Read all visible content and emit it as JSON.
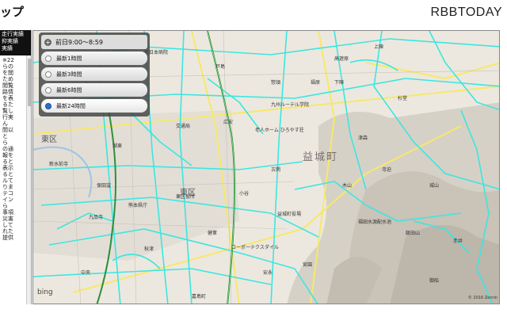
{
  "page": {
    "title": "ップ",
    "brand": "RBBTODAY"
  },
  "sidebar": {
    "header_lines": [
      "走行実績",
      "抑実績",
      "実績"
    ],
    "list_lines": [
      "※22",
      "らの",
      "を閲",
      "ため",
      "閲覧",
      "",
      "路情",
      "を表",
      "るた",
      "覧し",
      "行実",
      "ん",
      "",
      "間以",
      "と",
      "ら",
      "",
      "",
      "の通",
      "報を",
      "",
      "ると",
      "表示",
      "ると",
      "",
      "ルて",
      "りま",
      "テコ",
      "イン",
      "ら",
      "",
      "事項",
      "",
      "災害",
      "して",
      "れた",
      "提供"
    ]
  },
  "panel": {
    "header_label": "前日9:00～8:59",
    "options": [
      {
        "label": "最新1時間",
        "selected": false
      },
      {
        "label": "最新3時間",
        "selected": false
      },
      {
        "label": "最新6時間",
        "selected": false
      },
      {
        "label": "最新24時間",
        "selected": true
      }
    ]
  },
  "map": {
    "labels": {
      "town": "益城町",
      "ward1": "東区",
      "ward2": "東区",
      "tsuka": "通潤橋",
      "l1": "西日本病院",
      "l2": "九州ルーテル学院",
      "l3": "老人ホーム ひろやす荘",
      "l4": "益城町役場",
      "l5": "コーポーテクスダイル",
      "l6": "交通局",
      "l7": "東区役所",
      "l8": "熊本県庁",
      "l9": "健軍",
      "l10": "新水前寺",
      "l11": "福田水源配水池",
      "l12": "木山",
      "l13": "高遊原",
      "l14": "城山",
      "l15": "嘉島町",
      "l16": "御船",
      "l17": "広安",
      "l18": "惣領",
      "l19": "秋津",
      "l20": "湖東",
      "l21": "保田窪",
      "l22": "九品寺",
      "l23": "中央",
      "l24": "戸島",
      "l25": "杉堂",
      "l26": "福原",
      "l27": "飯田山",
      "l28": "赤井",
      "l29": "宮園",
      "l30": "津森",
      "l31": "上陳",
      "l32": "古閑",
      "l33": "安永",
      "l34": "小谷",
      "l35": "寺迫",
      "l36": "下陳"
    },
    "attribution": "bing",
    "copyright": "© 2016 Zenrin"
  },
  "colors": {
    "road_cyan": "#3ce6e0",
    "road_yellow": "#f7e86b",
    "highway_green": "#2f8f3a",
    "panel_bg": "#4a4a4a",
    "radio_selected": "#2d6ec7"
  }
}
